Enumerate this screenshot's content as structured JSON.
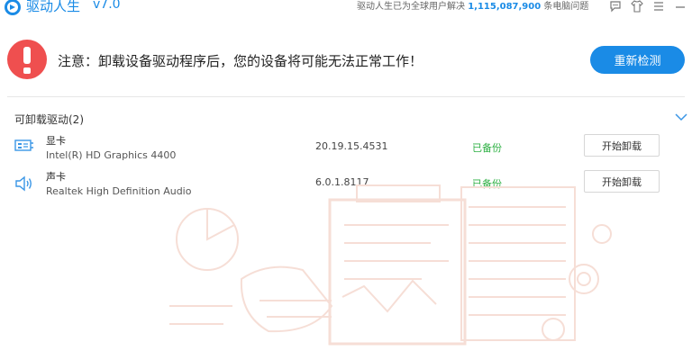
{
  "app": {
    "name": "驱动人生",
    "version": "v7.0",
    "user_info_prefix": "驱动人生已为全球用户解决",
    "user_count": "1,115,087,900",
    "user_info_suffix": "条电脑问题"
  },
  "warning": {
    "message": "注意：卸载设备驱动程序后，您的设备将可能无法正常工作！",
    "redetect_label": "重新检测"
  },
  "section": {
    "title": "可卸载驱动(2)"
  },
  "drivers": [
    {
      "type": "显卡",
      "name": "Intel(R) HD Graphics 4400",
      "version": "20.19.15.4531",
      "status": "已备份",
      "action": "开始卸载",
      "icon": "display-card-icon"
    },
    {
      "type": "声卡",
      "name": "Realtek High Definition Audio",
      "version": "6.0.1.8117",
      "status": "已备份",
      "action": "开始卸载",
      "icon": "speaker-icon"
    }
  ],
  "colors": {
    "accent": "#1a8be6",
    "warning": "#ef4f4f",
    "success": "#2db043"
  }
}
